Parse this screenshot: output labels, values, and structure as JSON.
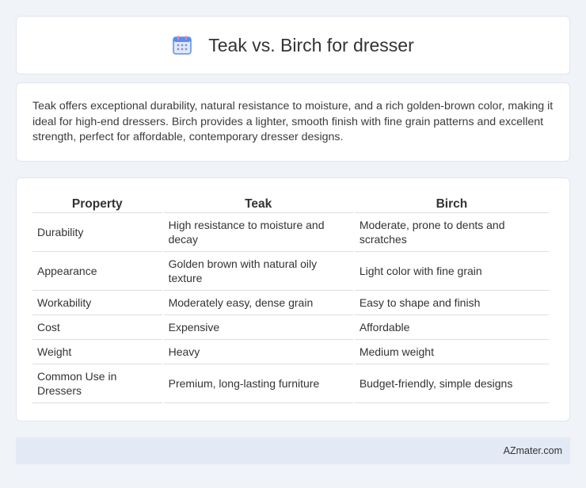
{
  "header": {
    "title": "Teak vs. Birch for dresser",
    "icon": "calendar-icon"
  },
  "intro": {
    "text": "Teak offers exceptional durability, natural resistance to moisture, and a rich golden-brown color, making it ideal for high-end dressers. Birch provides a lighter, smooth finish with fine grain patterns and excellent strength, perfect for affordable, contemporary dresser designs."
  },
  "table": {
    "headers": [
      "Property",
      "Teak",
      "Birch"
    ],
    "rows": [
      [
        "Durability",
        "High resistance to moisture and decay",
        "Moderate, prone to dents and scratches"
      ],
      [
        "Appearance",
        "Golden brown with natural oily texture",
        "Light color with fine grain"
      ],
      [
        "Workability",
        "Moderately easy, dense grain",
        "Easy to shape and finish"
      ],
      [
        "Cost",
        "Expensive",
        "Affordable"
      ],
      [
        "Weight",
        "Heavy",
        "Medium weight"
      ],
      [
        "Common Use in Dressers",
        "Premium, long-lasting furniture",
        "Budget-friendly, simple designs"
      ]
    ]
  },
  "footer": {
    "text": "AZmater.com"
  },
  "colors": {
    "background": "#f0f3f8",
    "card": "#ffffff",
    "footer": "#e3eaf5",
    "icon_blue": "#5b8def",
    "icon_pink": "#f08aa6"
  }
}
